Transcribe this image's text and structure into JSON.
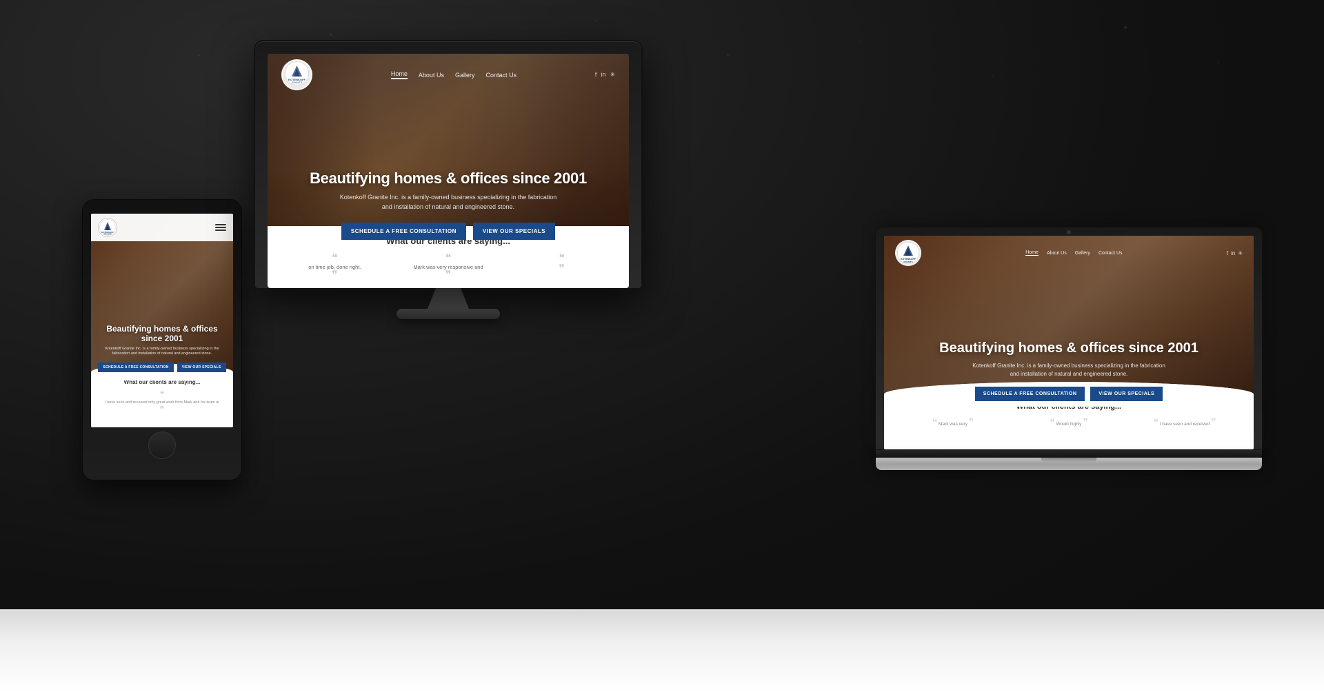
{
  "background": {
    "color": "#1a1a1a"
  },
  "desktop": {
    "nav": {
      "logo_text": "KOTENKOFF\nGRANITE",
      "links": [
        "Home",
        "About Us",
        "Gallery",
        "Contact Us"
      ],
      "active_link": "Home",
      "social": [
        "f",
        "in",
        "✳"
      ]
    },
    "hero": {
      "title": "Beautifying homes & offices since 2001",
      "subtitle": "Kotenkoff Granite Inc. is a family-owned business specializing in the fabrication and\ninstallation of natural and engineered stone.",
      "btn_primary": "SCHEDULE A FREE CONSULTATION",
      "btn_secondary": "VIEW OUR SPECIALS"
    },
    "testimonials_section": {
      "title": "What our clients are saying...",
      "items": [
        {
          "quote": "on time job, done right."
        },
        {
          "quote": "Mark was very responsive and"
        },
        {
          "quote": ""
        }
      ]
    }
  },
  "tablet": {
    "hero": {
      "title": "Beautifying homes & offices since 2001",
      "subtitle": "Kotenkoff Granite Inc. is a family-owned business specializing in the fabrication and installation of natural and engineered stone.",
      "btn_primary": "SCHEDULE A FREE CONSULTATION",
      "btn_secondary": "VIEW OUR SPECIALS"
    },
    "testimonials_section": {
      "title": "What our clients are saying...",
      "quote_text": "I have seen and received only great work from Mark and his team at"
    }
  },
  "laptop": {
    "nav": {
      "logo_text": "KOTENKOFF\nGRANITE",
      "links": [
        "Home",
        "About Us",
        "Gallery",
        "Contact Us"
      ],
      "active_link": "Home",
      "social": [
        "f",
        "in",
        "✳"
      ]
    },
    "hero": {
      "title": "Beautifying homes & offices since 2001",
      "subtitle": "Kotenkoff Granite Inc. is a family-owned business specializing in the fabrication and installation of natural and engineered stone.",
      "btn_primary": "SCHEDULE A FREE CONSULTATION",
      "btn_secondary": "VIEW OUR SPECIALS"
    },
    "testimonials_section": {
      "title": "What our clients are saying...",
      "items": [
        {
          "quote": "Mark was very"
        },
        {
          "quote": "Would highly"
        },
        {
          "quote": "I have seen and received"
        }
      ]
    }
  }
}
